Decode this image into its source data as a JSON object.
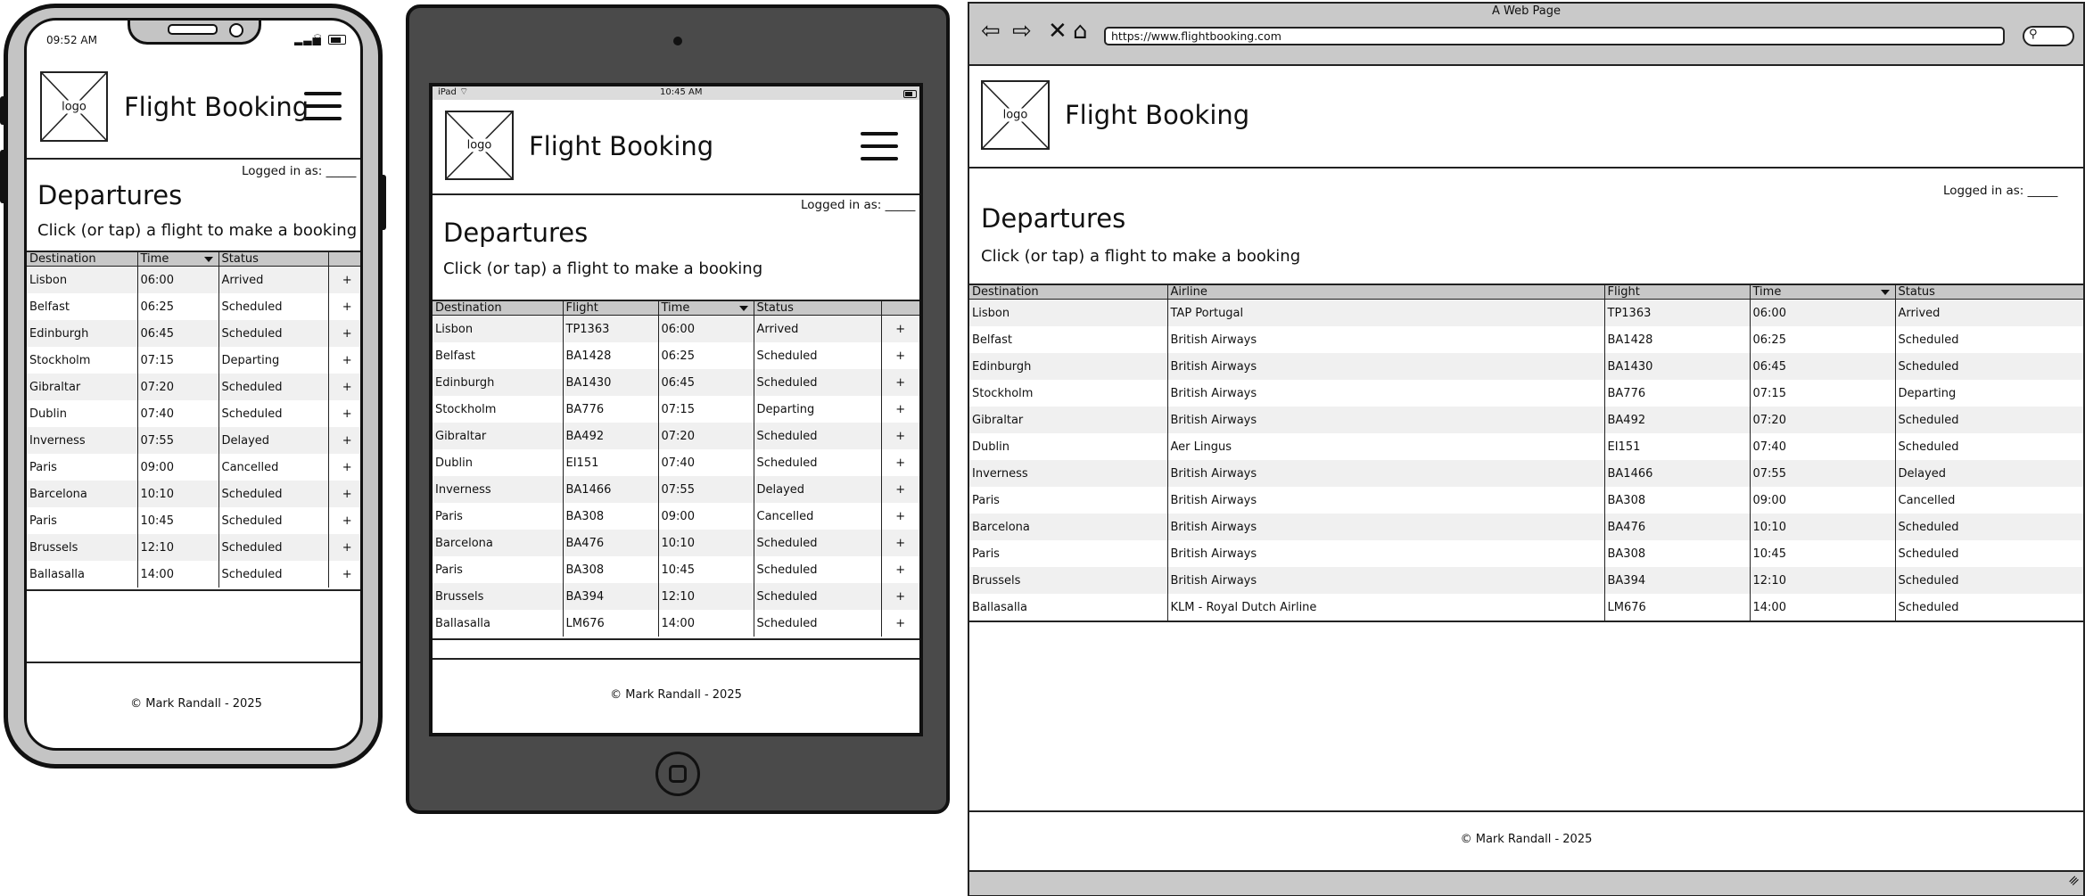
{
  "app": {
    "brand": "Flight Booking",
    "logo_label": "logo"
  },
  "page": {
    "logged_in": "Logged in as: _____",
    "heading": "Departures",
    "hint": "Click (or tap) a flight to make a booking",
    "footer": "© Mark Randall - 2025"
  },
  "phone": {
    "status_time": "09:52 AM"
  },
  "tablet": {
    "status_device": "iPad",
    "status_time": "10:45 AM"
  },
  "browser": {
    "window_title": "A Web Page",
    "url": "https://www.flightbooking.com"
  },
  "columns": {
    "destination": "Destination",
    "airline": "Airline",
    "flight": "Flight",
    "time": "Time",
    "status": "Status"
  },
  "book_symbol": "+",
  "flights": [
    {
      "destination": "Lisbon",
      "airline": "TAP Portugal",
      "flight": "TP1363",
      "time": "06:00",
      "status": "Arrived"
    },
    {
      "destination": "Belfast",
      "airline": "British Airways",
      "flight": "BA1428",
      "time": "06:25",
      "status": "Scheduled"
    },
    {
      "destination": "Edinburgh",
      "airline": "British Airways",
      "flight": "BA1430",
      "time": "06:45",
      "status": "Scheduled"
    },
    {
      "destination": "Stockholm",
      "airline": "British Airways",
      "flight": "BA776",
      "time": "07:15",
      "status": "Departing"
    },
    {
      "destination": "Gibraltar",
      "airline": "British Airways",
      "flight": "BA492",
      "time": "07:20",
      "status": "Scheduled"
    },
    {
      "destination": "Dublin",
      "airline": "Aer Lingus",
      "flight": "EI151",
      "time": "07:40",
      "status": "Scheduled"
    },
    {
      "destination": "Inverness",
      "airline": "British Airways",
      "flight": "BA1466",
      "time": "07:55",
      "status": "Delayed"
    },
    {
      "destination": "Paris",
      "airline": "British Airways",
      "flight": "BA308",
      "time": "09:00",
      "status": "Cancelled"
    },
    {
      "destination": "Barcelona",
      "airline": "British Airways",
      "flight": "BA476",
      "time": "10:10",
      "status": "Scheduled"
    },
    {
      "destination": "Paris",
      "airline": "British Airways",
      "flight": "BA308",
      "time": "10:45",
      "status": "Scheduled"
    },
    {
      "destination": "Brussels",
      "airline": "British Airways",
      "flight": "BA394",
      "time": "12:10",
      "status": "Scheduled"
    },
    {
      "destination": "Ballasalla",
      "airline": "KLM - Royal Dutch Airline",
      "flight": "LM676",
      "time": "14:00",
      "status": "Scheduled"
    }
  ]
}
